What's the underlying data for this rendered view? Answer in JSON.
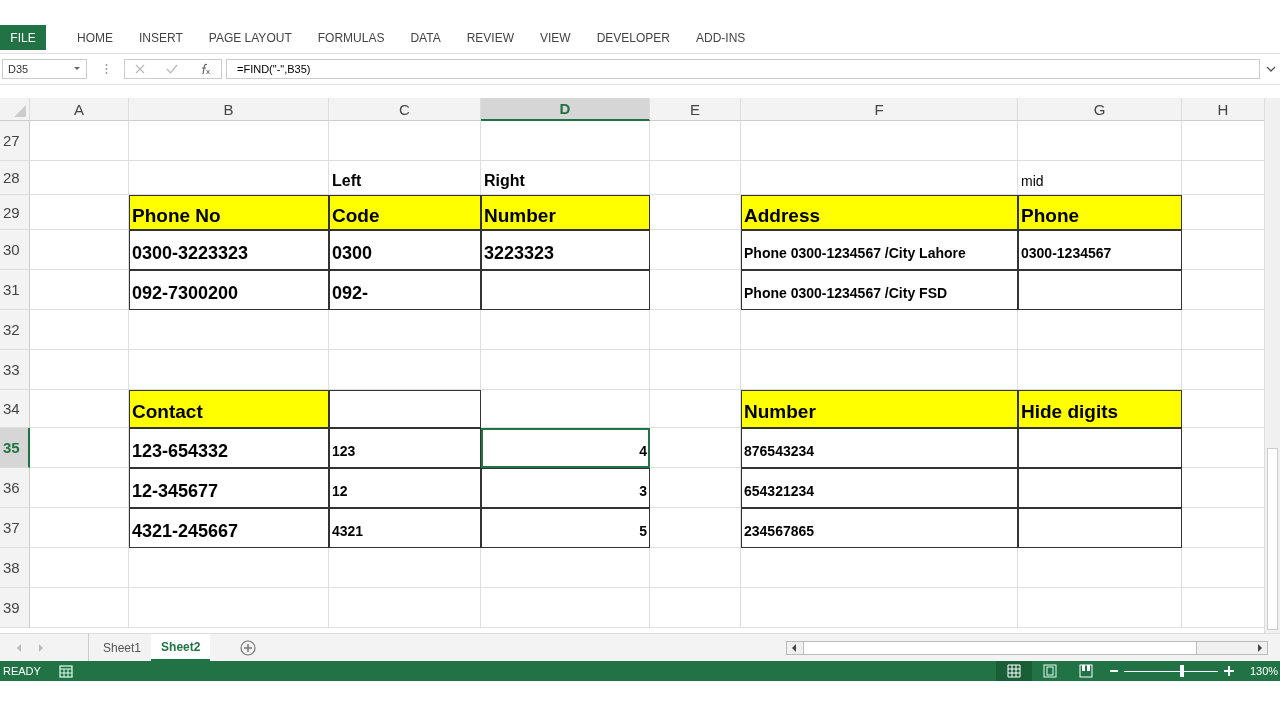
{
  "ribbon_tabs": [
    {
      "label": "FILE",
      "selected": true
    },
    {
      "label": "HOME",
      "selected": false
    },
    {
      "label": "INSERT",
      "selected": false
    },
    {
      "label": "PAGE LAYOUT",
      "selected": false
    },
    {
      "label": "FORMULAS",
      "selected": false
    },
    {
      "label": "DATA",
      "selected": false
    },
    {
      "label": "REVIEW",
      "selected": false
    },
    {
      "label": "VIEW",
      "selected": false
    },
    {
      "label": "DEVELOPER",
      "selected": false
    },
    {
      "label": "ADD-INS",
      "selected": false
    }
  ],
  "formula_bar": {
    "name_box": "D35",
    "formula": "=FIND(\"-\",B35)"
  },
  "columns": [
    {
      "label": "A",
      "selected": false
    },
    {
      "label": "B",
      "selected": false
    },
    {
      "label": "C",
      "selected": false
    },
    {
      "label": "D",
      "selected": true
    },
    {
      "label": "E",
      "selected": false
    },
    {
      "label": "F",
      "selected": false
    },
    {
      "label": "G",
      "selected": false
    },
    {
      "label": "H",
      "selected": false
    }
  ],
  "rows": [
    {
      "number": "27",
      "selected": false
    },
    {
      "number": "28",
      "selected": false,
      "cells": {
        "C": {
          "kind": "label",
          "text": "Left"
        },
        "D": {
          "kind": "label",
          "text": "Right"
        },
        "G": {
          "kind": "plain",
          "text": "mid"
        }
      }
    },
    {
      "number": "29",
      "selected": false,
      "cells": {
        "B": {
          "kind": "header",
          "text": "Phone No"
        },
        "C": {
          "kind": "header",
          "text": "Code"
        },
        "D": {
          "kind": "header",
          "text": "Number"
        },
        "F": {
          "kind": "header",
          "text": "Address"
        },
        "G": {
          "kind": "header",
          "text": "Phone"
        }
      }
    },
    {
      "number": "30",
      "selected": false,
      "cells": {
        "B": {
          "kind": "entry",
          "text": "0300-3223323"
        },
        "C": {
          "kind": "entry",
          "text": "0300"
        },
        "D": {
          "kind": "entry",
          "text": "3223323"
        },
        "F": {
          "kind": "small",
          "text": "Phone 0300-1234567 /City Lahore"
        },
        "G": {
          "kind": "small",
          "text": "0300-1234567"
        }
      }
    },
    {
      "number": "31",
      "selected": false,
      "cells": {
        "B": {
          "kind": "entry",
          "text": "092-7300200"
        },
        "C": {
          "kind": "entry",
          "text": "092-"
        },
        "D": {
          "kind": "box"
        },
        "F": {
          "kind": "small",
          "text": "Phone 0300-1234567 /City FSD"
        },
        "G": {
          "kind": "box"
        }
      }
    },
    {
      "number": "32",
      "selected": false
    },
    {
      "number": "33",
      "selected": false
    },
    {
      "number": "34",
      "selected": false,
      "cells": {
        "B": {
          "kind": "header",
          "text": "Contact"
        },
        "C": {
          "kind": "box"
        },
        "F": {
          "kind": "header",
          "text": "Number"
        },
        "G": {
          "kind": "header",
          "text": "Hide digits"
        }
      }
    },
    {
      "number": "35",
      "selected": true,
      "cells": {
        "B": {
          "kind": "entry",
          "text": "123-654332"
        },
        "C": {
          "kind": "small",
          "text": "123"
        },
        "D": {
          "kind": "number",
          "text": "4",
          "selected": true
        },
        "F": {
          "kind": "small",
          "text": "876543234"
        },
        "G": {
          "kind": "box"
        }
      }
    },
    {
      "number": "36",
      "selected": false,
      "cells": {
        "B": {
          "kind": "entry",
          "text": "12-345677"
        },
        "C": {
          "kind": "small",
          "text": "12"
        },
        "D": {
          "kind": "number",
          "text": "3",
          "selected": false
        },
        "F": {
          "kind": "small",
          "text": "654321234"
        },
        "G": {
          "kind": "box"
        }
      }
    },
    {
      "number": "37",
      "selected": false,
      "cells": {
        "B": {
          "kind": "entry",
          "text": "4321-245667"
        },
        "C": {
          "kind": "small",
          "text": "4321"
        },
        "D": {
          "kind": "number",
          "text": "5",
          "selected": false
        },
        "F": {
          "kind": "small",
          "text": "234567865"
        },
        "G": {
          "kind": "box"
        }
      }
    },
    {
      "number": "38",
      "selected": false
    },
    {
      "number": "39",
      "selected": false
    }
  ],
  "sheet_tabs": [
    {
      "label": "Sheet1",
      "selected": false
    },
    {
      "label": "Sheet2",
      "selected": true
    }
  ],
  "status_bar": {
    "status": "READY",
    "zoom": "130%",
    "level": 0.62
  }
}
